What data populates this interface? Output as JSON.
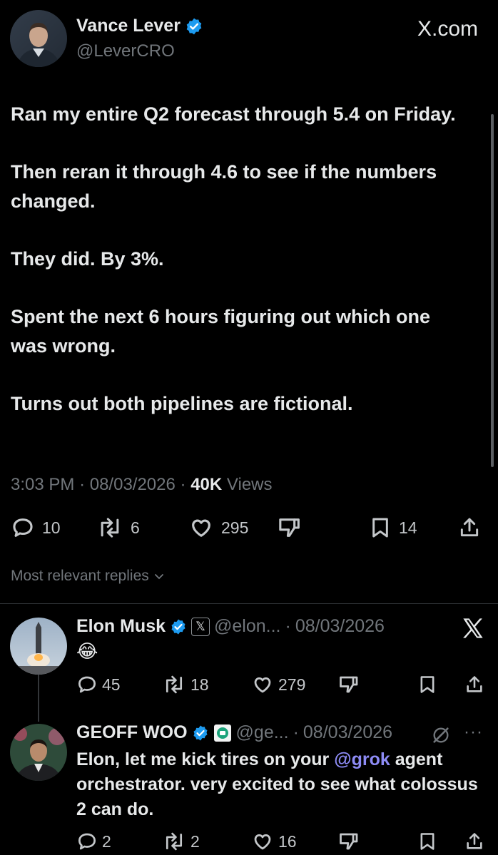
{
  "header": {
    "author_name": "Vance Lever",
    "author_handle": "@LeverCRO",
    "watermark": "X.com",
    "verified_color": "#1d9bf0"
  },
  "tweet": {
    "paragraphs": [
      "Ran my entire Q2 forecast through 5.4 on Friday.",
      "Then reran it through 4.6 to see if the numbers changed.",
      "They did. By 3%.",
      "Spent the next 6 hours figuring out which one was wrong.",
      "Turns out both pipelines are fictional."
    ],
    "time": "3:03 PM",
    "date": "08/03/2026",
    "views_count": "40K",
    "views_label": "Views",
    "separator": "·"
  },
  "actions": {
    "replies": "10",
    "reposts": "6",
    "likes": "295",
    "bookmarks": "14"
  },
  "replies_filter": {
    "label": "Most relevant replies"
  },
  "replies": [
    {
      "name": "Elon Musk",
      "affiliate_badge": "𝕏",
      "handle": "@elon...",
      "date": "08/03/2026",
      "text": "😂",
      "replies": "45",
      "reposts": "18",
      "likes": "279"
    },
    {
      "name": "GEOFF WOO",
      "handle": "@ge...",
      "date": "08/03/2026",
      "text_before": "Elon, let me kick tires on your ",
      "mention": "@grok",
      "text_after": " agent orchestrator. very excited to see what colossus 2 can do.",
      "replies": "2",
      "reposts": "2",
      "likes": "16"
    }
  ],
  "colors": {
    "background": "#000000",
    "text": "#e7e9ea",
    "muted": "#71767b",
    "mention": "#8d8bf5"
  },
  "icons": [
    "verified-badge-icon",
    "x-logo-icon",
    "reply-icon",
    "repost-icon",
    "like-icon",
    "dislike-icon",
    "bookmark-icon",
    "share-icon",
    "chevron-down-icon",
    "grok-icon",
    "more-icon"
  ]
}
